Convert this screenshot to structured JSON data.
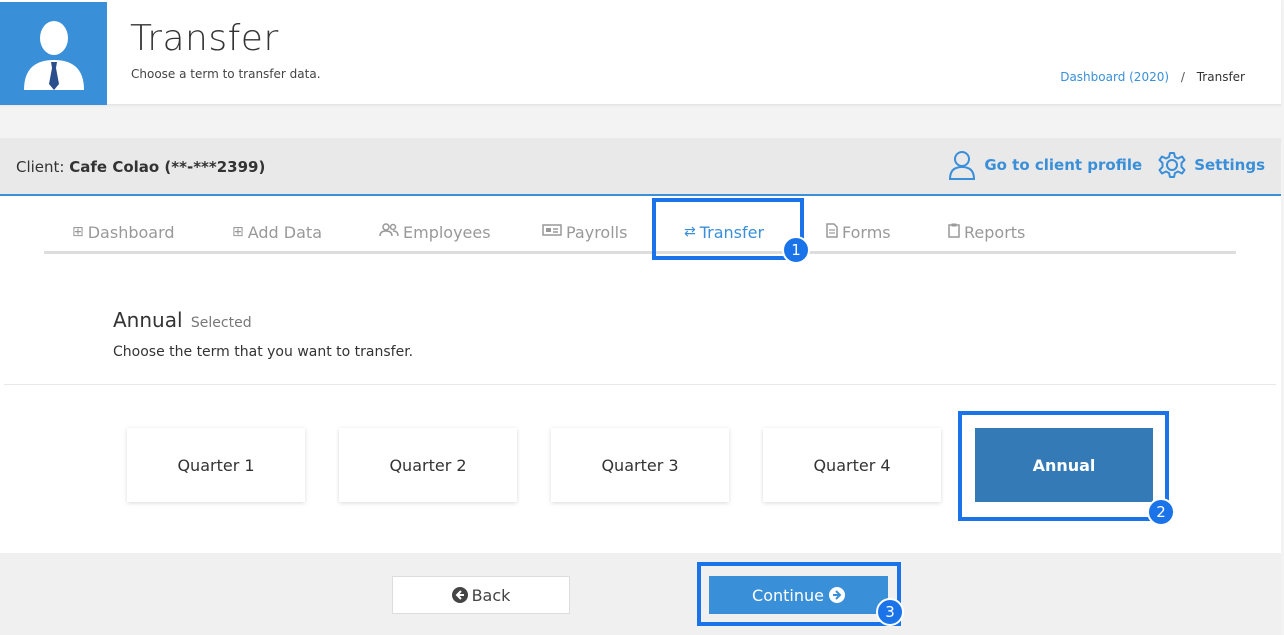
{
  "header": {
    "title": "Transfer",
    "subtitle": "Choose a term to transfer data.",
    "breadcrumb": {
      "link": "Dashboard (2020)",
      "separator": "/",
      "current": "Transfer"
    },
    "avatar_color": "#3a8fd9"
  },
  "client_bar": {
    "label": "Client:",
    "client_name": "Cafe Colao (**-***2399)",
    "profile_link": "Go to client profile",
    "settings_link": "Settings"
  },
  "tabs": [
    {
      "label": "Dashboard",
      "icon": "table-icon",
      "glyph": "⊞"
    },
    {
      "label": "Add Data",
      "icon": "plus-square-icon",
      "glyph": "⊞"
    },
    {
      "label": "Employees",
      "icon": "users-icon",
      "glyph": "👥"
    },
    {
      "label": "Payrolls",
      "icon": "money-icon",
      "glyph": "▭"
    },
    {
      "label": "Transfer",
      "icon": "exchange-icon",
      "glyph": "⇄",
      "active": true
    },
    {
      "label": "Forms",
      "icon": "file-icon",
      "glyph": "🗎"
    },
    {
      "label": "Reports",
      "icon": "clipboard-icon",
      "glyph": "📋"
    }
  ],
  "term_section": {
    "heading": "Annual",
    "selected_label": "Selected",
    "help": "Choose the term that you want to transfer."
  },
  "terms": [
    "Quarter 1",
    "Quarter 2",
    "Quarter 3",
    "Quarter 4",
    "Annual"
  ],
  "selected_term": "Annual",
  "footer": {
    "back_label": "Back",
    "continue_label": "Continue"
  },
  "callouts": [
    "1",
    "2",
    "3"
  ],
  "colors": {
    "accent": "#3a8fd9",
    "selected": "#337ab7",
    "callout": "#1a73e8"
  }
}
